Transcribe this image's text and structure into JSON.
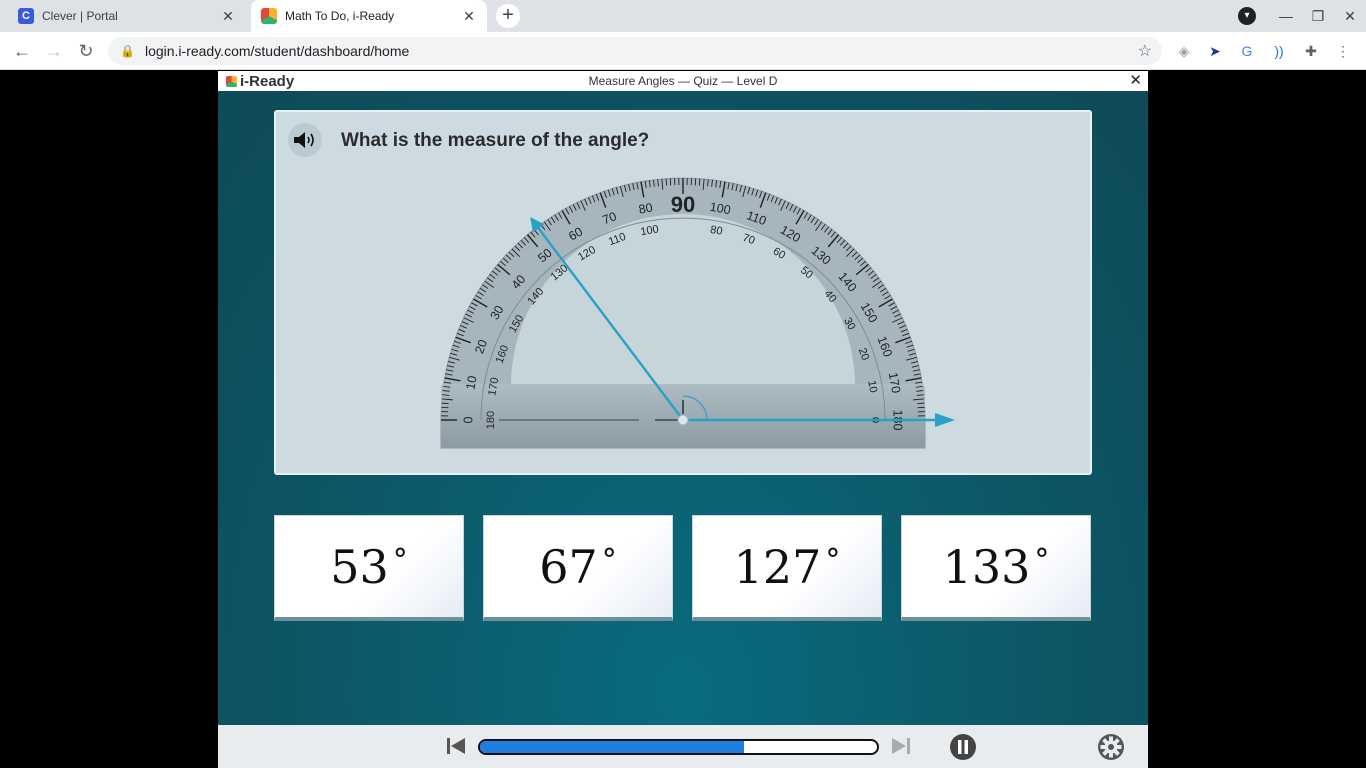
{
  "browser": {
    "tabs": [
      {
        "title": "Clever | Portal",
        "favicon": "C",
        "favicon_color": "#3b5bdb"
      },
      {
        "title": "Math To Do, i-Ready",
        "favicon": "",
        "favicon_color": "#f7b32b"
      }
    ],
    "url": "login.i-ready.com/student/dashboard/home"
  },
  "app": {
    "logo_text": "i-Ready",
    "lesson_title": "Measure Angles — Quiz — Level D",
    "close_label": "✕"
  },
  "question": {
    "text": "What is the measure of the angle?"
  },
  "protractor": {
    "angle_degrees": 127,
    "outer_labels": [
      "0",
      "10",
      "20",
      "30",
      "40",
      "50",
      "60",
      "70",
      "80",
      "90",
      "100",
      "110",
      "120",
      "130",
      "140",
      "150",
      "160",
      "170",
      "180"
    ],
    "inner_labels": [
      "180",
      "170",
      "160",
      "150",
      "140",
      "130",
      "120",
      "110",
      "100",
      "80",
      "70",
      "60",
      "50",
      "40",
      "30",
      "20",
      "10",
      "0"
    ],
    "ray_color": "#2aa0c8"
  },
  "choices": [
    {
      "value": "53",
      "unit": "°"
    },
    {
      "value": "67",
      "unit": "°"
    },
    {
      "value": "127",
      "unit": "°"
    },
    {
      "value": "133",
      "unit": "°"
    }
  ],
  "player": {
    "progress_percent": 66.5,
    "progress_color": "#1f7fe0"
  }
}
